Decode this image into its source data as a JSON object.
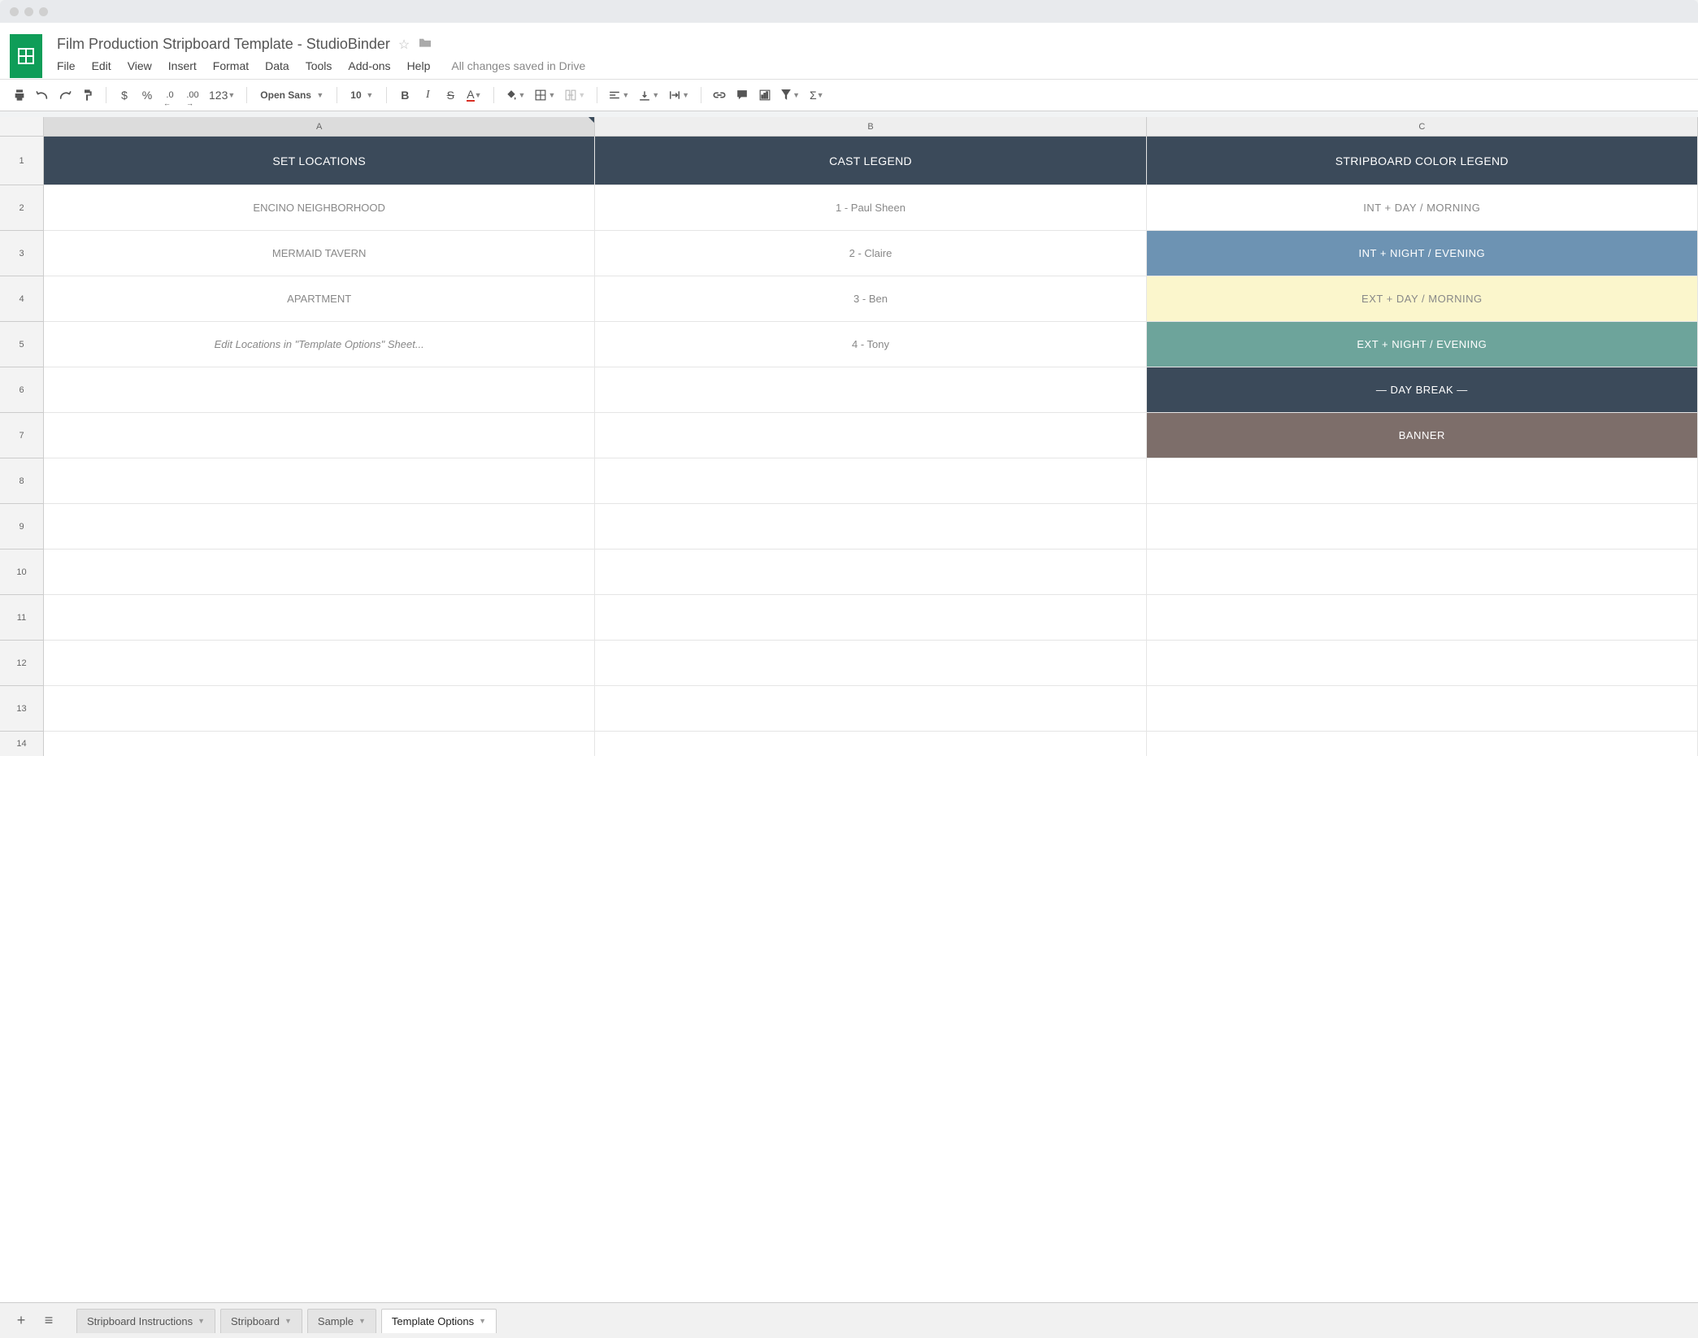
{
  "document": {
    "title": "Film Production Stripboard Template  -  StudioBinder"
  },
  "menus": [
    "File",
    "Edit",
    "View",
    "Insert",
    "Format",
    "Data",
    "Tools",
    "Add-ons",
    "Help"
  ],
  "save_status": "All changes saved in Drive",
  "toolbar": {
    "font_name": "Open Sans",
    "font_size": "10",
    "format123": "123",
    "currency": "$",
    "percent": "%",
    "dec_less": ".0",
    "dec_more": ".00"
  },
  "columns": [
    "A",
    "B",
    "C"
  ],
  "header_cells": [
    "SET LOCATIONS",
    "CAST LEGEND",
    "STRIPBOARD COLOR LEGEND"
  ],
  "data_rows": [
    {
      "num": "2",
      "a": "ENCINO NEIGHBORHOOD",
      "b": "1 - Paul Sheen",
      "c": "INT  +  DAY / MORNING",
      "c_class": "legend-white"
    },
    {
      "num": "3",
      "a": "MERMAID TAVERN",
      "b": "2 - Claire",
      "c": "INT  +  NIGHT / EVENING",
      "c_class": "legend-blue"
    },
    {
      "num": "4",
      "a": "APARTMENT",
      "b": "3 - Ben",
      "c": "EXT  +  DAY / MORNING",
      "c_class": "legend-cream"
    },
    {
      "num": "5",
      "a": "Edit Locations in \"Template Options\" Sheet...",
      "a_italic": true,
      "b": "4 - Tony",
      "c": "EXT  +  NIGHT / EVENING",
      "c_class": "legend-teal"
    },
    {
      "num": "6",
      "a": "",
      "b": "",
      "c": "— DAY BREAK —",
      "c_class": "legend-dark"
    },
    {
      "num": "7",
      "a": "",
      "b": "",
      "c": "BANNER",
      "c_class": "legend-brown"
    },
    {
      "num": "8",
      "a": "",
      "b": "",
      "c": "",
      "c_class": ""
    },
    {
      "num": "9",
      "a": "",
      "b": "",
      "c": "",
      "c_class": ""
    },
    {
      "num": "10",
      "a": "",
      "b": "",
      "c": "",
      "c_class": ""
    },
    {
      "num": "11",
      "a": "",
      "b": "",
      "c": "",
      "c_class": ""
    },
    {
      "num": "12",
      "a": "",
      "b": "",
      "c": "",
      "c_class": ""
    },
    {
      "num": "13",
      "a": "",
      "b": "",
      "c": "",
      "c_class": ""
    }
  ],
  "last_row_num": "14",
  "sheet_tabs": [
    {
      "label": "Stripboard Instructions",
      "active": false
    },
    {
      "label": "Stripboard",
      "active": false
    },
    {
      "label": "Sample",
      "active": false
    },
    {
      "label": "Template Options",
      "active": true
    }
  ]
}
